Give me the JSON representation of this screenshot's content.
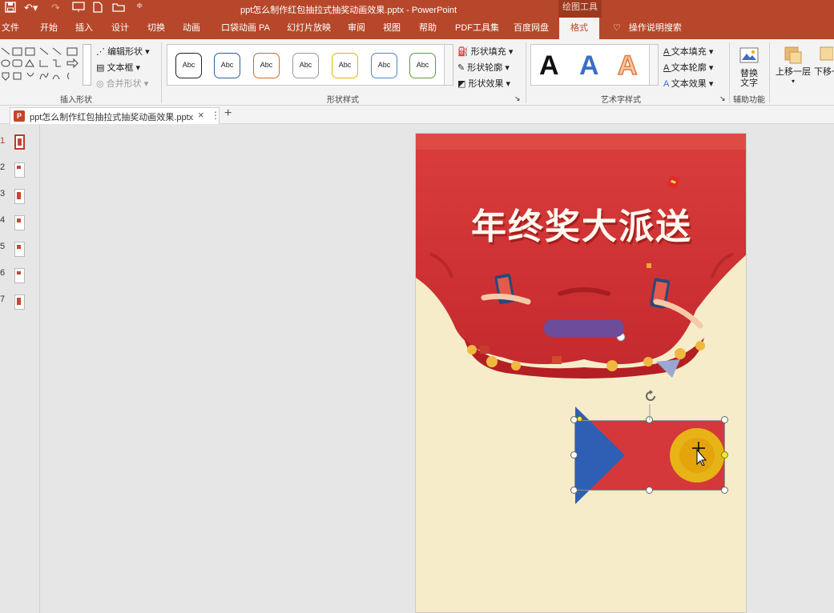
{
  "title_bar": {
    "document_title": "ppt怎么制作红包抽拉式抽奖动画效果.pptx  -  PowerPoint",
    "contextual_tab": "绘图工具"
  },
  "ribbon_tabs": [
    "文件",
    "开始",
    "插入",
    "设计",
    "切换",
    "动画",
    "口袋动画 PA",
    "幻灯片放映",
    "审阅",
    "视图",
    "帮助",
    "PDF工具集",
    "百度网盘",
    "格式"
  ],
  "active_tab": "格式",
  "tell_me": "操作说明搜索",
  "groups": {
    "insert_shapes": {
      "label": "插入形状",
      "edit_shape": "编辑形状",
      "text_box": "文本框",
      "merge_shapes": "合并形状"
    },
    "shape_styles": {
      "label": "形状样式",
      "style_samples": [
        {
          "text": "Abc",
          "border": "#222222"
        },
        {
          "text": "Abc",
          "border": "#2e5fa0"
        },
        {
          "text": "Abc",
          "border": "#d46a28"
        },
        {
          "text": "Abc",
          "border": "#9a9a9a"
        },
        {
          "text": "Abc",
          "border": "#e8b100"
        },
        {
          "text": "Abc",
          "border": "#4a86c5"
        },
        {
          "text": "Abc",
          "border": "#5c9c3c"
        }
      ],
      "shape_fill": "形状填充",
      "shape_outline": "形状轮廓",
      "shape_effects": "形状效果"
    },
    "wordart_styles": {
      "label": "艺术字样式",
      "samples": [
        {
          "text": "A",
          "color": "#111111"
        },
        {
          "text": "A",
          "color": "#3b6fc6"
        },
        {
          "text": "A",
          "color": "#f4a46a"
        }
      ],
      "text_fill": "文本填充",
      "text_outline": "文本轮廓",
      "text_effects": "文本效果"
    },
    "accessibility": {
      "label": "辅助功能",
      "alt_text_line1": "替换",
      "alt_text_line2": "文字"
    },
    "arrange": {
      "bring_forward": "上移一层",
      "send_backward": "下移一"
    }
  },
  "doc_tab": {
    "name": "ppt怎么制作红包抽拉式抽奖动画效果.pptx"
  },
  "thumbnails": [
    "1",
    "2",
    "3",
    "4",
    "5",
    "6",
    "7"
  ],
  "active_slide": "1",
  "slide": {
    "headline": "年终奖大派送"
  },
  "colors": {
    "brand_red": "#b7472a",
    "envelope_red": "#d4383a",
    "background_cream": "#f6ecc9",
    "triangle_blue": "#2f5fb5",
    "circle_gold": "#e7b416"
  }
}
